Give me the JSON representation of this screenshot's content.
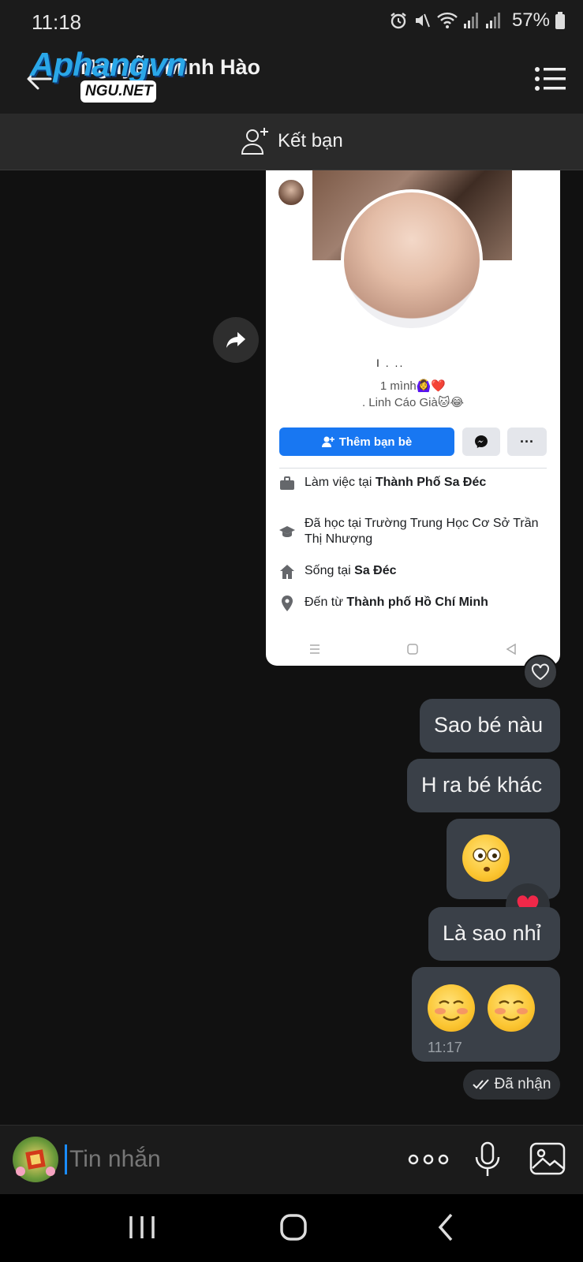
{
  "status_bar": {
    "time": "11:18",
    "battery": "57%"
  },
  "header": {
    "contact_name": "Nguyễn Minh Hào"
  },
  "watermark": {
    "brand": "Aphangvn",
    "badge": "NGU.NET"
  },
  "add_friend_bar": {
    "label": "Kết bạn"
  },
  "shared_profile": {
    "name_redacted": "I . ..",
    "bio_line1": "1 mình🙆‍♀️❤️",
    "bio_line2": ". Linh Cáo Già🐱😂",
    "add_friend_button": "Thêm bạn bè",
    "more_button": "···",
    "info": [
      {
        "icon": "briefcase-icon",
        "prefix": "Làm việc tại ",
        "bold": "Thành Phố Sa Đéc"
      },
      {
        "icon": "graduation-cap-icon",
        "prefix": "Đã học tại Trường Trung Học Cơ Sở Trần Thị Nhượng",
        "bold": ""
      },
      {
        "icon": "home-icon",
        "prefix": "Sống tại ",
        "bold": "Sa Đéc"
      },
      {
        "icon": "location-pin-icon",
        "prefix": "Đến từ ",
        "bold": "Thành phố Hồ Chí Minh"
      }
    ]
  },
  "messages": [
    {
      "text": "Sao bé nàu"
    },
    {
      "text": "H ra bé khác"
    },
    {
      "emoji": "flushed-face"
    },
    {
      "text": "Là sao nhỉ"
    },
    {
      "emoji": "blushing-face",
      "time": "11:17"
    }
  ],
  "delivery_status": "Đã nhận",
  "input": {
    "placeholder": "Tin nhắn"
  },
  "colors": {
    "bubble": "#3a4048",
    "accent_blue": "#1877f2",
    "background": "#111111"
  }
}
